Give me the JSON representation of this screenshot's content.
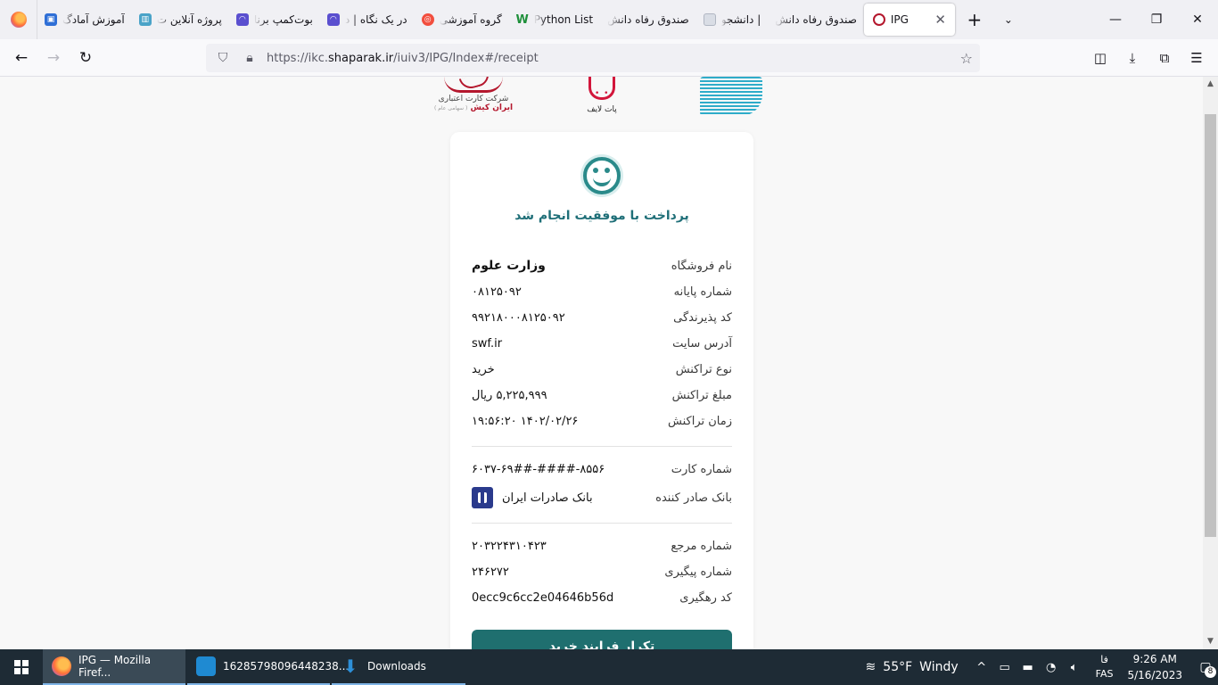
{
  "browser": {
    "tabs": [
      {
        "label": "آموزش آمادگ",
        "icon": "image-icon",
        "color": "#2f6fd6"
      },
      {
        "label": "پروژه آنلاین ت",
        "icon": "book-icon",
        "color": "#4aa3c8"
      },
      {
        "label": "بوت‌کمپ برنا",
        "icon": "app-icon",
        "color": "#5a4fcf"
      },
      {
        "label": "در یک نگاه | د",
        "icon": "app-icon",
        "color": "#5a4fcf"
      },
      {
        "label": "گروه آموزشی",
        "icon": "circle-icon",
        "color": "#f24e3e"
      },
      {
        "label": "Python List",
        "icon": "w-icon",
        "color": "#1e8f3a"
      },
      {
        "label": "صندوق رفاه دانش",
        "icon": "blank-icon",
        "color": "#f0f0f4"
      },
      {
        "label": "دانشجو | ",
        "icon": "doc-icon",
        "color": "#b0b6c2"
      },
      {
        "label": "صندوق رفاه دانش",
        "icon": "blank-icon",
        "color": "#f0f0f4"
      }
    ],
    "active_tab": {
      "label": "IPG",
      "close": "✕"
    },
    "new_tab": "+",
    "tab_list": "⌄",
    "window_controls": {
      "minimize": "—",
      "restore": "❐",
      "close": "✕"
    },
    "nav": {
      "back": "←",
      "forward": "→",
      "reload": "↻"
    },
    "url_prefix": "https://ikc.",
    "url_domain": "shaparak.ir",
    "url_path": "/iuiv3/IPG/Index#/receipt",
    "tools": {
      "pocket": "◫",
      "downloads": "⤓",
      "extensions": "⧉",
      "menu": "☰"
    }
  },
  "header_logos": {
    "irankish_line1": "شرکت کارت اعتباری",
    "irankish_line2": "ایران کیش",
    "irankish_small": "( سهامی عام )",
    "patlife": "پات لایف",
    "shaparak_alt": "شبکه الکترونیکی پرداخت کارت"
  },
  "receipt": {
    "title": "پرداخت با موفقیت انجام شد",
    "fields": [
      {
        "label": "نام فروشگاه",
        "value": "وزارت علوم"
      },
      {
        "label": "شماره پایانه",
        "value": "۰۸۱۲۵۰۹۲"
      },
      {
        "label": "کد پذیرندگی",
        "value": "۹۹۲۱۸۰۰۰۸۱۲۵۰۹۲"
      },
      {
        "label": "آدرس سایت",
        "value": "swf.ir"
      },
      {
        "label": "نوع تراکنش",
        "value": "خرید"
      },
      {
        "label": "مبلغ تراکنش",
        "value": "۵,۲۲۵,۹۹۹ ریال"
      },
      {
        "label": "زمان تراکنش",
        "value": "۱۹:۵۶:۲۰ ۱۴۰۲/۰۲/۲۶"
      }
    ],
    "card_fields": [
      {
        "label": "شماره کارت",
        "value": "۶۰۳۷-۶۹##-####-۸۵۵۶"
      },
      {
        "label": "بانک صادر کننده",
        "value": "بانک صادرات ایران"
      }
    ],
    "ref_fields": [
      {
        "label": "شماره مرجع",
        "value": "۲۰۳۲۲۴۳۱۰۴۲۳"
      },
      {
        "label": "شماره پیگیری",
        "value": "۲۴۶۲۷۲"
      },
      {
        "label": "کد رهگیری",
        "value": "0ecc9c6cc2e04646b56d"
      }
    ],
    "repeat_button": "تکرار فرایند خرید"
  },
  "taskbar": {
    "items": [
      {
        "label": "IPG — Mozilla Firef...",
        "color": "#ff7139"
      },
      {
        "label": "16285798096448238...",
        "color": "#1f8ad2"
      },
      {
        "label": "Downloads",
        "color": "#2d8fd8"
      }
    ],
    "weather_temp": "55°F",
    "weather_text": "Windy",
    "tray_up": "^",
    "lang_top": "فا",
    "lang_bottom": "FAS",
    "time": "9:26 AM",
    "date": "5/16/2023",
    "notifications": "8"
  },
  "colors": {
    "accent": "#1f6f78",
    "button": "#1f6f6f",
    "irankish": "#b4172d",
    "patlife": "#d2163b",
    "shaparak": "#18a3c4",
    "saderat": "#2a3a8c"
  }
}
